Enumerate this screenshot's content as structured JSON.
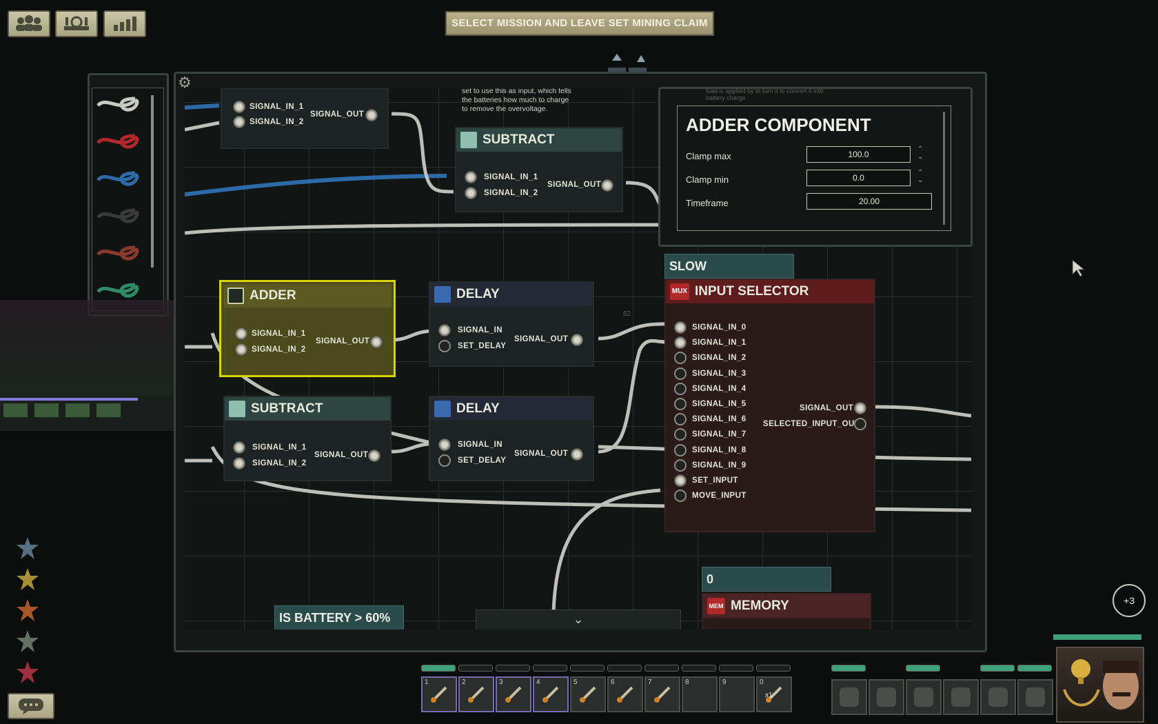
{
  "top_bar": {
    "crew_icon": "crew-icon",
    "command_icon": "command-icon",
    "stats_icon": "stats-icon",
    "mission_button": "SELECT MISSION AND LEAVE SET MINING CLAIM"
  },
  "editor": {
    "settings_icon": "gear-icon",
    "background_tooltip": "set to use this as input, which tells the batteries how much to charge to remove the overvoltage.",
    "background_tooltip_right": "load is applied by to turn it to convert it into battery charge",
    "collapse_icon": "chevron-down-icon",
    "grid_number": "62"
  },
  "wire_palette": {
    "items": [
      {
        "name": "white-wire",
        "color": "#c9c9c4"
      },
      {
        "name": "red-wire",
        "color": "#b3272b"
      },
      {
        "name": "blue-wire",
        "color": "#2c6aa8"
      },
      {
        "name": "black-wire",
        "color": "#3a3a38"
      },
      {
        "name": "brown-wire",
        "color": "#8a3a2c"
      },
      {
        "name": "green-wire",
        "color": "#2f8a66"
      }
    ]
  },
  "nodes": {
    "top_left": {
      "in1": "SIGNAL_IN_1",
      "in2": "SIGNAL_IN_2",
      "out": "SIGNAL_OUT"
    },
    "subtract_top": {
      "title": "SUBTRACT",
      "in1": "SIGNAL_IN_1",
      "in2": "SIGNAL_IN_2",
      "out": "SIGNAL_OUT"
    },
    "adder": {
      "title": "ADDER",
      "in1": "SIGNAL_IN_1",
      "in2": "SIGNAL_IN_2",
      "out": "SIGNAL_OUT"
    },
    "delay_top": {
      "title": "DELAY",
      "in": "SIGNAL_IN",
      "set": "SET_DELAY",
      "out": "SIGNAL_OUT"
    },
    "subtract_bottom": {
      "title": "SUBTRACT",
      "in1": "SIGNAL_IN_1",
      "in2": "SIGNAL_IN_2",
      "out": "SIGNAL_OUT"
    },
    "delay_bottom": {
      "title": "DELAY",
      "in": "SIGNAL_IN",
      "set": "SET_DELAY",
      "out": "SIGNAL_OUT"
    },
    "input_selector": {
      "label": "SLOW IN-/DECREASE",
      "badge": "MUX",
      "title": "INPUT SELECTOR",
      "inputs": [
        "SIGNAL_IN_0",
        "SIGNAL_IN_1",
        "SIGNAL_IN_2",
        "SIGNAL_IN_3",
        "SIGNAL_IN_4",
        "SIGNAL_IN_5",
        "SIGNAL_IN_6",
        "SIGNAL_IN_7",
        "SIGNAL_IN_8",
        "SIGNAL_IN_9",
        "SET_INPUT",
        "MOVE_INPUT"
      ],
      "out": "SIGNAL_OUT",
      "selected_out": "SELECTED_INPUT_OUT"
    },
    "memory": {
      "label": "0",
      "badge": "MEM",
      "title": "MEMORY"
    },
    "battery_label": "IS BATTERY > 60%"
  },
  "tooltip": {
    "title": "ADDER COMPONENT",
    "clamp_max_label": "Clamp max",
    "clamp_max_value": "100.0",
    "clamp_min_label": "Clamp min",
    "clamp_min_value": "0.0",
    "timeframe_label": "Timeframe",
    "timeframe_value": "20.00"
  },
  "hotbar": {
    "slots": [
      {
        "num": "1",
        "icon": "screwdriver-icon"
      },
      {
        "num": "2",
        "icon": "wrench-icon"
      },
      {
        "num": "3",
        "icon": "smg-icon"
      },
      {
        "num": "4",
        "icon": "screwdriver-icon"
      },
      {
        "num": "5",
        "icon": "diving-mask-icon"
      },
      {
        "num": "6",
        "icon": "flashlight-icon"
      },
      {
        "num": "7",
        "icon": "welding-tool-icon"
      },
      {
        "num": "8",
        "icon": "empty-slot-icon"
      },
      {
        "num": "9",
        "icon": "empty-slot-icon"
      },
      {
        "num": "0",
        "icon": "syringe-icon"
      }
    ],
    "syringe_count": "x1",
    "equipment": [
      "rifle-icon",
      "helmet-icon",
      "jacket-icon",
      "headset-icon",
      "handcuffs-icon",
      "id-card-icon"
    ]
  },
  "side_icons": [
    "assistant-talent-icon",
    "engineer-talent-icon",
    "security-talent-icon",
    "medic-talent-icon",
    "medical-cross-icon"
  ],
  "chat_icon": "chat-icon",
  "notification_count": "+3",
  "portrait_icon": "character-portrait-icon",
  "colors": {
    "adder_highlight": "#d9d400",
    "selector_header": "#6a1c1c",
    "label_panel": "#2b4a4a"
  }
}
